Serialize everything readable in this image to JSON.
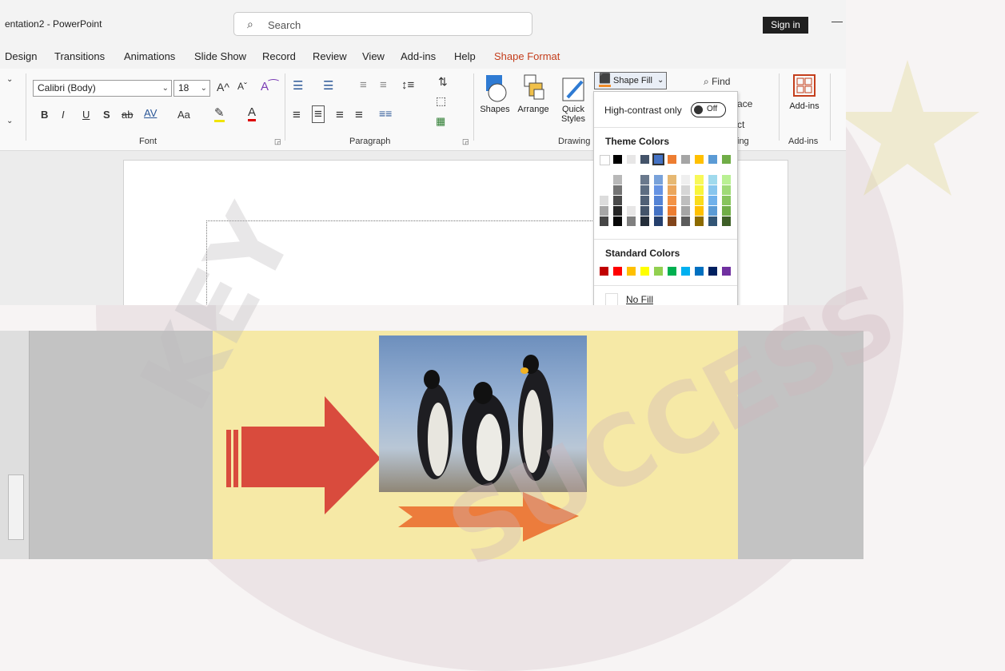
{
  "window": {
    "title": "entation2 - PowerPoint"
  },
  "search": {
    "placeholder": "Search"
  },
  "account": {
    "sign_in_label": "Sign in"
  },
  "tabs": [
    {
      "label": "Design"
    },
    {
      "label": "Transitions"
    },
    {
      "label": "Animations"
    },
    {
      "label": "Slide Show"
    },
    {
      "label": "Record"
    },
    {
      "label": "Review"
    },
    {
      "label": "View"
    },
    {
      "label": "Add-ins"
    },
    {
      "label": "Help"
    },
    {
      "label": "Shape Format"
    }
  ],
  "font_group": {
    "font_name": "Calibri (Body)",
    "font_size": "18",
    "bold": "B",
    "italic": "I",
    "underline": "U",
    "shadow": "S",
    "strike": "ab",
    "spacing": "AV",
    "change_case": "Aa",
    "grow": "A^",
    "shrink": "Aˇ",
    "label": "Font"
  },
  "paragraph_group": {
    "label": "Paragraph"
  },
  "drawing_group": {
    "shapes_label": "Shapes",
    "arrange_label": "Arrange",
    "quick_styles_label_1": "Quick",
    "quick_styles_label_2": "Styles",
    "label": "Drawing"
  },
  "editing_group": {
    "find_label": "Find",
    "replace_label": "ace",
    "select_label": "ct",
    "label": "ing"
  },
  "addins_group": {
    "button_label": "Add-ins",
    "label": "Add-ins"
  },
  "shape_fill": {
    "button_label": "Shape Fill",
    "high_contrast_label": "High-contrast only",
    "toggle_state": "Off",
    "theme_colors_label": "Theme Colors",
    "standard_colors_label": "Standard Colors",
    "no_fill_label": "No Fill",
    "theme_colors": [
      "#ffffff",
      "#000000",
      "#e7e6e6",
      "#44546a",
      "#4472c4",
      "#ed7d31",
      "#a5a5a5",
      "#ffc000",
      "#5b9bd5",
      "#70ad47"
    ],
    "standard_colors": [
      "#c00000",
      "#ff0000",
      "#ffc000",
      "#ffff00",
      "#92d050",
      "#00b050",
      "#00b0f0",
      "#0070c0",
      "#002060",
      "#7030a0"
    ]
  },
  "watermark": {
    "line1": "KEY",
    "line2": "SUCCESS"
  },
  "colors": {
    "accent": "#c43e1c",
    "ribbon": "#f9f9f9",
    "slide_bg": "#f6e9a6"
  }
}
